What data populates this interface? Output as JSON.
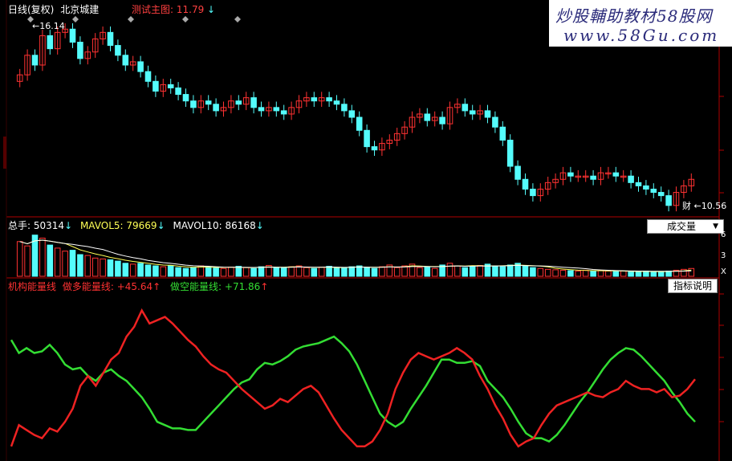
{
  "header": {
    "period": "日线(复权)",
    "stock_name": "北京城建",
    "indicator": "测试主图: 11.79"
  },
  "watermark": {
    "line1": "炒股輔助教材58股网",
    "line2": "www.58Gu.com"
  },
  "price_labels": {
    "high": "16.14",
    "low": "10.56",
    "low_mark": "财"
  },
  "volume_panel": {
    "label_total": "总手:",
    "total": "50314",
    "mavol5_label": "MAVOL5:",
    "mavol5": "79669",
    "mavol10_label": "MAVOL10:",
    "mavol10": "86168",
    "dropdown": "成交量",
    "axis_ticks": [
      "6",
      "3",
      "X"
    ]
  },
  "indicator_panel": {
    "inst_label": "机构能量线",
    "long_label": "做多能量线:",
    "long_value": "+45.64",
    "short_label": "做空能量线:",
    "short_value": "+71.86",
    "button": "指标说明"
  },
  "colors": {
    "up": "#ff3232",
    "down": "#54fcfc",
    "green_line": "#33dd33",
    "red_line": "#ee2222",
    "border": "#b00000",
    "mavol5": "#ffff55",
    "mavol10": "#ffffff"
  },
  "chart_data": [
    {
      "type": "candlestick",
      "title": "北京城建 日线(复权)",
      "close": [
        14.6,
        15.2,
        14.9,
        15.8,
        15.4,
        15.9,
        16.0,
        15.6,
        15.1,
        15.3,
        15.7,
        15.9,
        15.5,
        15.2,
        14.9,
        15.0,
        14.7,
        14.4,
        14.1,
        14.3,
        14.2,
        14.0,
        13.8,
        13.6,
        13.8,
        13.7,
        13.5,
        13.6,
        13.8,
        13.7,
        13.9,
        13.6,
        13.5,
        13.6,
        13.5,
        13.4,
        13.6,
        13.8,
        13.9,
        13.8,
        13.9,
        13.8,
        13.7,
        13.5,
        13.3,
        12.9,
        12.4,
        12.3,
        12.5,
        12.6,
        12.8,
        13.0,
        13.3,
        13.4,
        13.2,
        13.3,
        13.1,
        13.6,
        13.7,
        13.5,
        13.4,
        13.5,
        13.3,
        13.0,
        12.6,
        11.8,
        11.4,
        11.1,
        10.9,
        11.1,
        11.3,
        11.4,
        11.6,
        11.5,
        11.5,
        11.5,
        11.4,
        11.6,
        11.6,
        11.5,
        11.5,
        11.3,
        11.2,
        11.1,
        11.0,
        10.9,
        10.6,
        11.0,
        11.2,
        11.4
      ],
      "high": 16.14,
      "low": 10.56
    },
    {
      "type": "bar",
      "title": "成交量",
      "values": [
        80,
        70,
        95,
        88,
        72,
        65,
        58,
        60,
        50,
        48,
        42,
        40,
        38,
        35,
        30,
        28,
        30,
        26,
        24,
        22,
        25,
        20,
        18,
        20,
        24,
        22,
        19,
        18,
        21,
        23,
        20,
        18,
        22,
        25,
        20,
        19,
        22,
        24,
        20,
        18,
        21,
        23,
        19,
        20,
        22,
        24,
        20,
        18,
        22,
        26,
        20,
        24,
        28,
        20,
        22,
        18,
        26,
        30,
        24,
        20,
        22,
        25,
        28,
        24,
        22,
        26,
        30,
        24,
        20,
        18,
        16,
        15,
        14,
        13,
        12,
        14,
        12,
        13,
        12,
        11,
        12,
        10,
        11,
        12,
        10,
        11,
        12,
        14,
        16,
        18
      ],
      "series": [
        {
          "name": "MAVOL5",
          "value": 79669
        },
        {
          "name": "MAVOL10",
          "value": 86168
        }
      ]
    },
    {
      "type": "line",
      "series": [
        {
          "name": "做多能量线",
          "values": [
            70,
            62,
            65,
            62,
            63,
            67,
            62,
            55,
            52,
            53,
            48,
            45,
            50,
            52,
            48,
            45,
            40,
            35,
            28,
            20,
            18,
            16,
            16,
            15,
            15,
            20,
            25,
            30,
            35,
            40,
            44,
            46,
            52,
            56,
            55,
            57,
            60,
            64,
            66,
            67,
            68,
            70,
            72,
            68,
            63,
            55,
            45,
            35,
            25,
            20,
            17,
            20,
            28,
            35,
            42,
            50,
            58,
            58,
            56,
            56,
            57,
            54,
            45,
            40,
            35,
            28,
            20,
            13,
            10,
            10,
            8,
            12,
            18,
            25,
            32,
            38,
            45,
            52,
            58,
            62,
            65,
            64,
            60,
            55,
            50,
            45,
            38,
            32,
            25,
            20
          ]
        },
        {
          "name": "做空能量线",
          "values": [
            5,
            18,
            15,
            12,
            10,
            16,
            14,
            20,
            28,
            42,
            48,
            42,
            50,
            58,
            62,
            72,
            78,
            88,
            80,
            82,
            84,
            80,
            75,
            70,
            66,
            60,
            55,
            52,
            50,
            45,
            40,
            36,
            32,
            28,
            30,
            34,
            32,
            36,
            40,
            42,
            38,
            30,
            22,
            15,
            10,
            5,
            5,
            8,
            15,
            25,
            40,
            50,
            58,
            62,
            60,
            58,
            60,
            62,
            65,
            62,
            58,
            48,
            40,
            30,
            22,
            12,
            5,
            8,
            10,
            18,
            25,
            30,
            32,
            34,
            36,
            38,
            36,
            35,
            38,
            40,
            45,
            42,
            40,
            40,
            38,
            40,
            35,
            36,
            40,
            46
          ]
        }
      ]
    }
  ]
}
